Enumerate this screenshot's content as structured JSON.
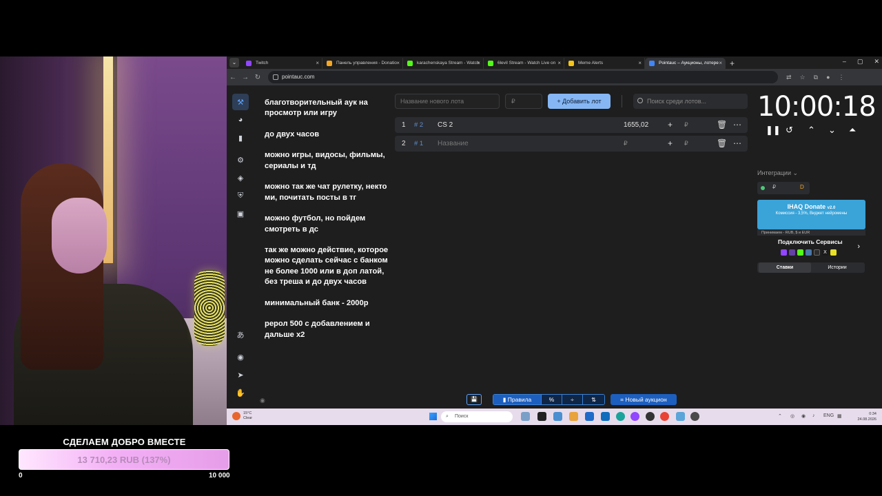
{
  "browser": {
    "tabs": [
      {
        "label": "Twitch",
        "color": "#9146ff",
        "active": false
      },
      {
        "label": "Панель управления - Donatio",
        "color": "#f5a623",
        "active": false
      },
      {
        "label": "karachenskaya Stream - Watch",
        "color": "#53fc18",
        "active": false
      },
      {
        "label": "6levil Stream - Watch Live on",
        "color": "#53fc18",
        "active": false
      },
      {
        "label": "Meme Alerts",
        "color": "#f5c518",
        "active": false
      },
      {
        "label": "Pointauc – Аукционы, лотере",
        "color": "#4285f4",
        "active": true
      }
    ],
    "url": "pointauc.com"
  },
  "description": [
    "благотворительный аук на просмотр или игру",
    "до  двух часов",
    "можно игры, видосы, фильмы, сериалы и тд",
    "можно так же чат рулетку, некто ми, почитать посты в тг",
    "можно футбол, но пойдем смотреть в дс",
    "так же можно действие, которое можно сделать сейчас с банком не более 1000 или в доп латой, без треша  и до двух часов",
    "минимальный банк - 2000р",
    "рерол 500 с добавлением и дальше х2"
  ],
  "controls": {
    "lot_placeholder": "Название нового лота",
    "price_placeholder": "₽",
    "add_label": "Добавить лот",
    "search_placeholder": "Поиск среди лотов..."
  },
  "lots": [
    {
      "index": "1",
      "tag": "# 2",
      "name": "CS 2",
      "amount": "1655,02",
      "rub": "₽"
    },
    {
      "index": "2",
      "tag": "# 1",
      "name": "Название",
      "amount": "₽",
      "rub": "₽"
    }
  ],
  "timer": "10:00:18",
  "integrations": {
    "label": "Интеграции",
    "currency": "₽",
    "ihaq_title": "IHAQ Donate",
    "ihaq_version": "v2.0",
    "ihaq_sub": "Комиссия - 3,5%, Виджет нейромены",
    "ihaq_foot": "Принимаем - RUB, $ и EUR",
    "services_label": "Подключить Сервисы"
  },
  "side_tabs": [
    "Ставки",
    "Истории"
  ],
  "bottom": {
    "rules": "Правила",
    "percent": "%",
    "new_auction": "Новый аукцион"
  },
  "taskbar": {
    "weather_temp": "15°C",
    "weather_state": "Clear",
    "search": "Поиск",
    "lang": "ENG",
    "time": "0:34",
    "date": "24.08.2026"
  },
  "donation": {
    "title": "СДЕЛАЕМ ДОБРО ВМЕСТЕ",
    "amount": "13 710,23 RUB (137%)",
    "progress_percent": 137,
    "min": "0",
    "max": "10 000"
  }
}
